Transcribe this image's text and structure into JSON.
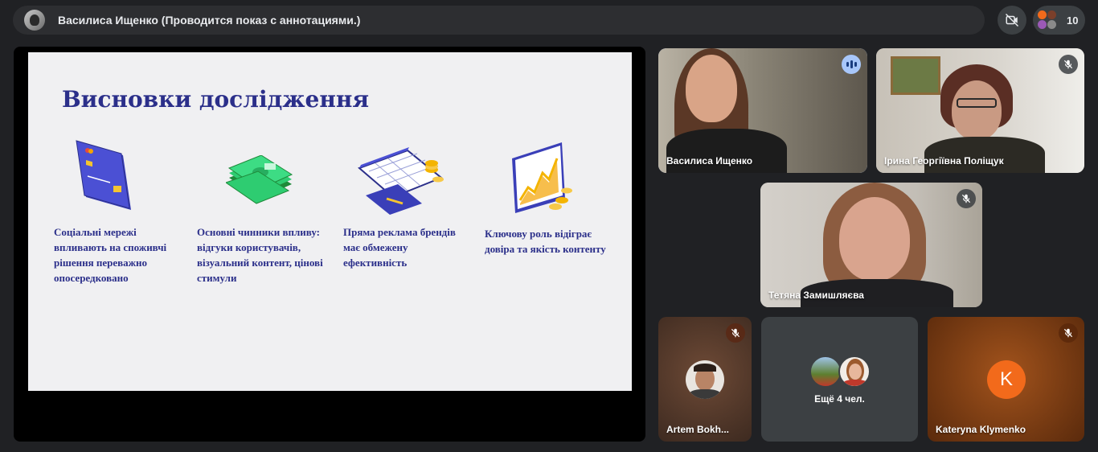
{
  "topbar": {
    "presenter_title": "Василиса Ищенко (Проводится показ с аннотациями.)",
    "participant_count": "10",
    "camera_off_icon": "camera-off-icon",
    "people_icon": "people-icon"
  },
  "slide": {
    "title": "Висновки дослідження",
    "columns": [
      {
        "icon": "credit-card-icon",
        "text": "Соціальні мережі\nвпливають на споживчі\nрішення переважно\nопосередковано"
      },
      {
        "icon": "money-stack-icon",
        "text": "Основні чинники впливу:\nвідгуки користувачів,\nвізуальний контент, цінові\nстимули"
      },
      {
        "icon": "calendar-coins-icon",
        "text": "Пряма реклама брендів\nмає обмежену\nефективність"
      },
      {
        "icon": "chart-monitor-icon",
        "text": "Ключову роль відіграє\nдовіра та якість контенту"
      }
    ]
  },
  "participants": [
    {
      "name": "Василиса Ищенко",
      "state": "speaking"
    },
    {
      "name": "Ірина Георгіївна Поліщук",
      "state": "muted"
    },
    {
      "name": "Тетяна Замишляєва",
      "state": "muted"
    },
    {
      "name": "Artem Bokh...",
      "state": "muted"
    },
    {
      "name": "Ещё 4 чел.",
      "state": "group"
    },
    {
      "name": "Kateryna Klymenko",
      "state": "muted",
      "initial": "K"
    }
  ],
  "colors": {
    "background": "#202124",
    "slide_text": "#2b2f8a",
    "accent_active": "#a8c7fa",
    "avatar_orange": "#f26a1b"
  }
}
